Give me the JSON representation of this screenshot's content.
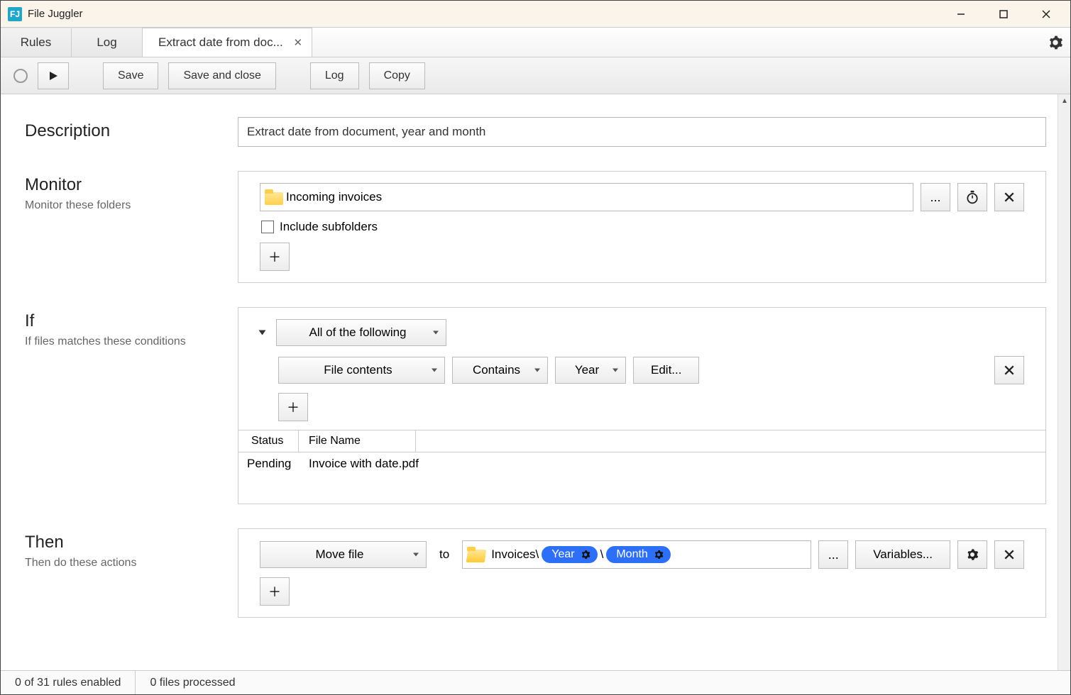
{
  "app": {
    "title": "File Juggler",
    "icon_letters": "FJ"
  },
  "tabs": {
    "nav": [
      "Rules",
      "Log"
    ],
    "doc": "Extract date from doc..."
  },
  "toolbar": {
    "save": "Save",
    "save_close": "Save and close",
    "log": "Log",
    "copy": "Copy"
  },
  "sections": {
    "description": {
      "title": "Description",
      "value": "Extract date from document, year and month"
    },
    "monitor": {
      "title": "Monitor",
      "sub": "Monitor these folders",
      "folder": "Incoming invoices",
      "browse": "...",
      "include_subfolders": "Include subfolders"
    },
    "if": {
      "title": "If",
      "sub": "If files matches these conditions",
      "group_mode": "All of the following",
      "cond": {
        "field": "File contents",
        "op": "Contains",
        "arg": "Year",
        "edit": "Edit..."
      },
      "table": {
        "headers": {
          "status": "Status",
          "fname": "File Name"
        },
        "row": {
          "status": "Pending",
          "fname": "Invoice with date.pdf"
        }
      }
    },
    "then": {
      "title": "Then",
      "sub": "Then do these actions",
      "action": "Move file",
      "to_label": "to",
      "dest_prefix": "Invoices\\",
      "pill1": "Year",
      "sep": "\\",
      "pill2": "Month",
      "browse": "...",
      "variables": "Variables..."
    }
  },
  "status": {
    "rules": "0 of 31 rules enabled",
    "files": "0 files processed"
  }
}
